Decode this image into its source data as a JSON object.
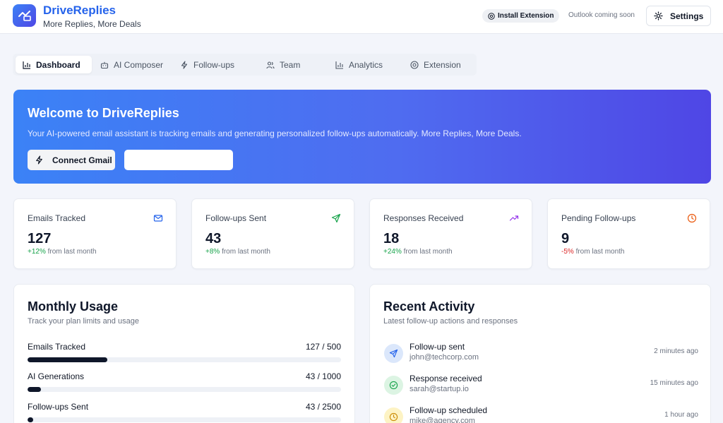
{
  "header": {
    "brand_name": "DriveReplies",
    "tagline": "More Replies, More Deals",
    "install_extension": "Install Extension",
    "outlook_note": "Outlook coming soon",
    "settings": "Settings"
  },
  "tabs": [
    {
      "label": "Dashboard",
      "icon": "bar-chart-icon",
      "active": true
    },
    {
      "label": "AI Composer",
      "icon": "bot-icon",
      "active": false
    },
    {
      "label": "Follow-ups",
      "icon": "lightning-icon",
      "active": false
    },
    {
      "label": "Team",
      "icon": "users-icon",
      "active": false
    },
    {
      "label": "Analytics",
      "icon": "bar-chart-icon",
      "active": false
    },
    {
      "label": "Extension",
      "icon": "chrome-icon",
      "active": false
    }
  ],
  "hero": {
    "title": "Welcome to DriveReplies",
    "subtitle": "Your AI-powered email assistant is tracking emails and generating personalized follow-ups automatically. More Replies, More Deals.",
    "connect_button": "Connect Gmail"
  },
  "stats": [
    {
      "label": "Emails Tracked",
      "value": "127",
      "change": "+12%",
      "change_suffix": "from last month",
      "icon": "mail-icon",
      "color": "#2563eb"
    },
    {
      "label": "Follow-ups Sent",
      "value": "43",
      "change": "+8%",
      "change_suffix": "from last month",
      "icon": "send-icon",
      "color": "#16a34a"
    },
    {
      "label": "Responses Received",
      "value": "18",
      "change": "+24%",
      "change_suffix": "from last month",
      "icon": "trending-up-icon",
      "color": "#9333ea"
    },
    {
      "label": "Pending Follow-ups",
      "value": "9",
      "change": "-5%",
      "change_suffix": "from last month",
      "icon": "clock-icon",
      "color": "#ea580c"
    }
  ],
  "usage": {
    "title": "Monthly Usage",
    "subtitle": "Track your plan limits and usage",
    "items": [
      {
        "label": "Emails Tracked",
        "value": "127 / 500",
        "fraction": 0.254
      },
      {
        "label": "AI Generations",
        "value": "43 / 1000",
        "fraction": 0.043
      },
      {
        "label": "Follow-ups Sent",
        "value": "43 / 2500",
        "fraction": 0.0172
      }
    ]
  },
  "activity": {
    "title": "Recent Activity",
    "subtitle": "Latest follow-up actions and responses",
    "items": [
      {
        "title": "Follow-up sent",
        "email": "john@techcorp.com",
        "time": "2 minutes ago",
        "icon": "send-icon"
      },
      {
        "title": "Response received",
        "email": "sarah@startup.io",
        "time": "15 minutes ago",
        "icon": "check-circle-icon"
      },
      {
        "title": "Follow-up scheduled",
        "email": "mike@agency.com",
        "time": "1 hour ago",
        "icon": "clock-icon"
      }
    ]
  }
}
